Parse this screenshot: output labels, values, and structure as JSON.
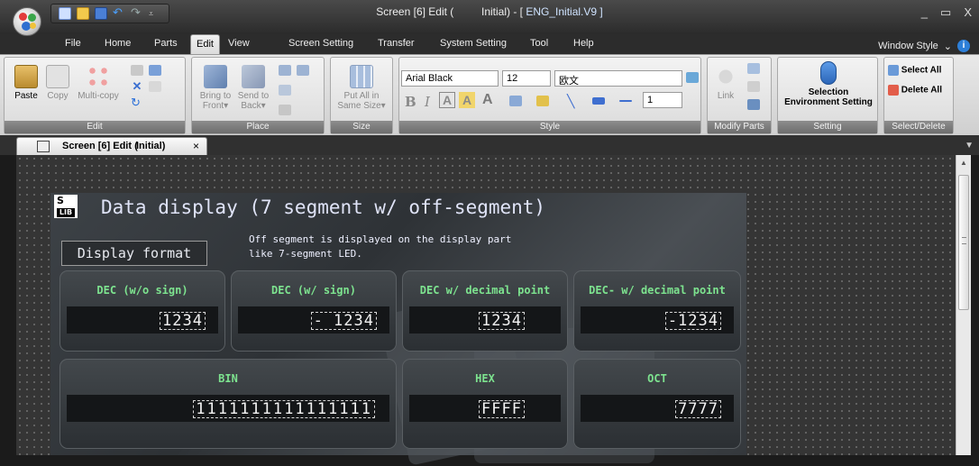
{
  "titlebar": {
    "title_main": "Screen [6] Edit (",
    "title_sub": "Initial) - [",
    "title_file": "ENG_Initial.V9",
    "title_end": "]",
    "min": "_",
    "restore": "▭",
    "close": "X"
  },
  "menu": {
    "tabs": [
      "File",
      "Home",
      "Parts",
      "Edit",
      "View",
      "Screen Setting",
      "Transfer",
      "System Setting",
      "Tool",
      "Help"
    ],
    "active": "Edit",
    "window_style": "Window Style",
    "window_style_arrow": "⌄",
    "info": "i"
  },
  "ribbon": {
    "edit": {
      "label": "Edit",
      "paste": "Paste",
      "copy": "Copy",
      "multicopy": "Multi-copy"
    },
    "place": {
      "label": "Place",
      "front": "Bring to Front▾",
      "back": "Send to Back▾"
    },
    "size": {
      "label": "Size",
      "putall": "Put All in Same Size▾"
    },
    "style": {
      "label": "Style",
      "font": "Arial Black",
      "size": "12",
      "lang": "欧文",
      "linewidth": "1"
    },
    "modify": {
      "label": "Modify Parts",
      "link": "Link"
    },
    "setting": {
      "label": "Setting",
      "selection": "Selection Environment Setting"
    },
    "seldel": {
      "label": "Select/Delete",
      "select_all": "Select All",
      "delete_all": "Delete All"
    }
  },
  "doc_tab": {
    "a": "Screen [6] Edit (",
    "b": "Initial)",
    "close": "×"
  },
  "panel": {
    "logo_s": "S",
    "logo_lib": "LIB",
    "title": "Data display (7 segment w/ off-segment)",
    "desc_line1": "Off segment is displayed on the display part",
    "desc_line2": "like 7-segment LED.",
    "format_label": "Display format",
    "cards": [
      {
        "label": "DEC (w/o sign)",
        "value": "1234"
      },
      {
        "label": "DEC (w/ sign)",
        "value": "- 1234"
      },
      {
        "label": "DEC w/ decimal point",
        "value": "1234"
      },
      {
        "label": "DEC- w/ decimal point",
        "value": "-1234"
      },
      {
        "label": "BIN",
        "value": "1111111111111111"
      },
      {
        "label": "HEX",
        "value": "FFFF"
      },
      {
        "label": "OCT",
        "value": "7777"
      }
    ]
  },
  "colors": {
    "accent_green": "#7de38f",
    "ribbon_active": "#f1f1f1",
    "link_title": "#cfe3ff"
  }
}
